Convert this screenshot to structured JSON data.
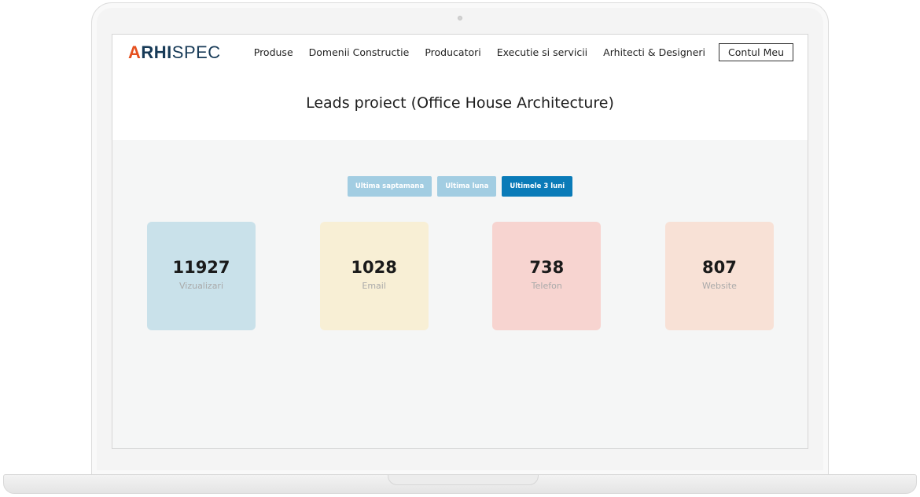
{
  "brand": {
    "logo_a": "A",
    "logo_rhi": "RHI",
    "logo_spec": "SPEC"
  },
  "nav": {
    "items": [
      {
        "label": "Produse"
      },
      {
        "label": "Domenii Constructie"
      },
      {
        "label": "Producatori"
      },
      {
        "label": "Executie si servicii"
      },
      {
        "label": "Arhitecti & Designeri"
      }
    ],
    "account_label": "Contul Meu"
  },
  "page": {
    "title": "Leads proiect (Office House Architecture)"
  },
  "filters": [
    {
      "label": "Ultima saptamana",
      "active": false
    },
    {
      "label": "Ultima luna",
      "active": false
    },
    {
      "label": "Ultimele 3 luni",
      "active": true
    }
  ],
  "stats": [
    {
      "value": "11927",
      "label": "Vizualizari",
      "color": "#c9e1ea"
    },
    {
      "value": "1028",
      "label": "Email",
      "color": "#f8efd5"
    },
    {
      "value": "738",
      "label": "Telefon",
      "color": "#f7d4d0"
    },
    {
      "value": "807",
      "label": "Website",
      "color": "#f8e1d6"
    }
  ],
  "colors": {
    "accent": "#0a7bb8",
    "filter_inactive": "#a2cde2",
    "logo_orange": "#e5501f",
    "logo_navy": "#173a57"
  }
}
